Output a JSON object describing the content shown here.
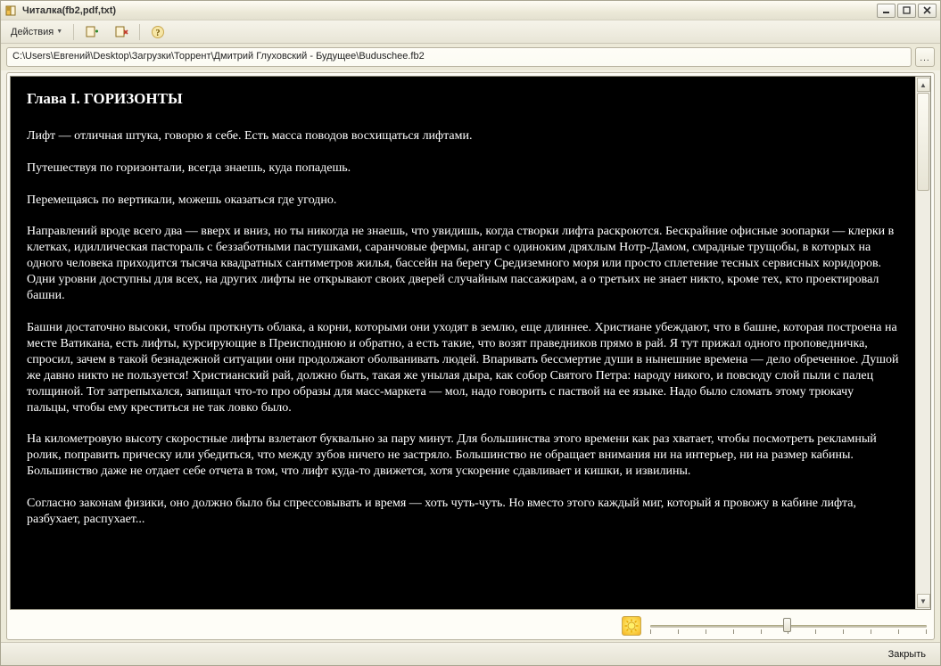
{
  "window": {
    "title": "Читалка(fb2,pdf,txt)"
  },
  "toolbar": {
    "actions_label": "Действия",
    "icon1_tip": "book-add",
    "icon2_tip": "book-remove",
    "help_tip": "help"
  },
  "pathbar": {
    "path": "C:\\Users\\Евгений\\Desktop\\Загрузки\\Торрент\\Дмитрий Глуховский - Будущее\\Buduschee.fb2",
    "browse_label": "..."
  },
  "content": {
    "heading": "Глава I. ГОРИЗОНТЫ",
    "p1": "Лифт — отличная штука, говорю я себе. Есть масса поводов восхищаться лифтами.",
    "p2": "Путешествуя по горизонтали, всегда знаешь, куда попадешь.",
    "p3": "Перемещаясь по вертикали, можешь оказаться где угодно.",
    "p4": "Направлений вроде всего два — вверх и вниз, но ты никогда не знаешь, что увидишь, когда створки лифта раскроются. Бескрайние офисные зоопарки — клерки в клетках, идиллическая пастораль с беззаботными пастушками, саранчовые фермы, ангар с одиноким дряхлым Нотр-Дамом, смрадные трущобы, в которых на одного человека приходится тысяча квадратных сантиметров жилья, бассейн на берегу Средиземного моря или просто сплетение тесных сервисных коридоров. Одни уровни доступны для всех, на других лифты не открывают своих дверей случайным пассажирам, а о третьих не знает никто, кроме тех, кто проектировал башни.",
    "p5": "Башни достаточно высоки, чтобы проткнуть облака, а корни, которыми они уходят в землю, еще длиннее. Христиане убеждают, что в башне, которая построена на месте Ватикана, есть лифты, курсирующие в Преисподнюю и обратно, а есть такие, что возят праведников прямо в рай. Я тут прижал одного проповедничка, спросил, зачем в такой безнадежной ситуации они продолжают оболванивать людей. Впаривать бессмертие души в нынешние времена — дело обреченное. Душой же давно никто не пользуется! Христианский рай, должно быть, такая же унылая дыра, как собор Святого Петра: народу никого, и повсюду слой пыли с палец толщиной. Тот затрепыхался, запищал что-то про образы для масс-маркета — мол, надо говорить с паствой на ее языке. Надо было сломать этому трюкачу пальцы, чтобы ему креститься не так ловко было.",
    "p6": "На километровую высоту скоростные лифты взлетают буквально за пару минут. Для большинства этого времени как раз хватает, чтобы посмотреть рекламный ролик, поправить прическу или убедиться, что между зубов ничего не застряло. Большинство не обращает внимания ни на интерьер, ни на размер кабины. Большинство даже не отдает себе отчета в том, что лифт куда-то движется, хотя ускорение сдавливает и кишки, и извилины.",
    "p7": "Согласно законам физики, оно должно было бы спрессовывать и время — хоть чуть-чуть. Но вместо этого каждый миг, который я провожу в кабине лифта, разбухает, распухает..."
  },
  "footer": {
    "close_label": "Закрыть"
  }
}
